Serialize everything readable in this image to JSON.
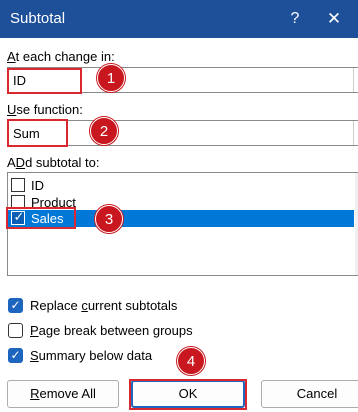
{
  "window": {
    "title": "Subtotal",
    "help_label": "?",
    "close_label": "✕"
  },
  "change_field": {
    "label_mnemonic": "A",
    "label_rest": "t each change in:",
    "value": "ID"
  },
  "function_field": {
    "label_mnemonic": "U",
    "label_rest": "se function:",
    "value": "Sum"
  },
  "subtotal_list": {
    "label_mnemonic": "D",
    "label_pre": "A",
    "label_rest": "d subtotal to:",
    "items": [
      {
        "label": "ID",
        "checked": false,
        "selected": false
      },
      {
        "label": "Product",
        "checked": false,
        "selected": false
      },
      {
        "label": "Sales",
        "checked": true,
        "selected": true
      }
    ]
  },
  "options": {
    "replace": {
      "pre": "Replace ",
      "mnemonic": "c",
      "rest": "urrent subtotals",
      "checked": true
    },
    "page_break": {
      "pre": "",
      "mnemonic": "P",
      "rest": "age break between groups",
      "checked": false
    },
    "summary": {
      "pre": "",
      "mnemonic": "S",
      "rest": "ummary below data",
      "checked": true
    }
  },
  "buttons": {
    "remove_all_mnemonic": "R",
    "remove_all_rest": "emove All",
    "ok": "OK",
    "cancel": "Cancel"
  },
  "annotations": {
    "badge1": "1",
    "badge2": "2",
    "badge3": "3",
    "badge4": "4"
  },
  "colors": {
    "title_bar": "#1e4f99",
    "annotation_red": "#c8171e",
    "selection_blue": "#0078d7"
  }
}
